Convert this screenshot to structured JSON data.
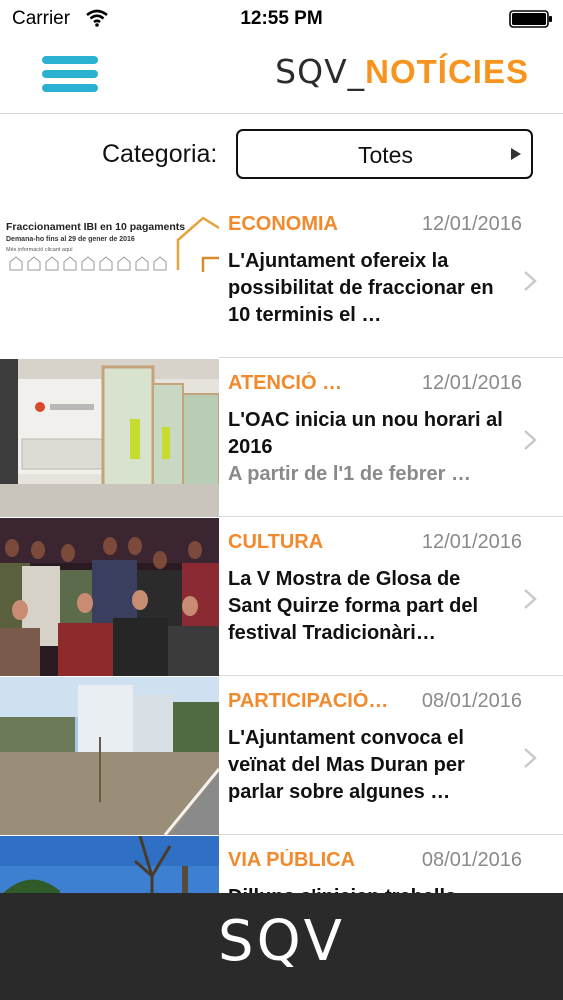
{
  "status_bar": {
    "carrier": "Carrier",
    "time": "12:55 PM"
  },
  "nav": {
    "brand_prefix": "SQV_",
    "brand_suffix": "NOTÍCIES"
  },
  "filter": {
    "label": "Categoria:",
    "value": "Totes"
  },
  "news": [
    {
      "category": "ECONOMIA",
      "date": "12/01/2016",
      "title": "L'Ajuntament ofereix la possibilitat de fraccionar en 10 terminis el …",
      "subtitle": "",
      "thumb": {
        "line1": "Fraccionament IBI en 10 pagaments",
        "line2": "Demana-ho fins al 29 de gener de 2016",
        "line3": "Més informació clicant aquí"
      }
    },
    {
      "category": "ATENCIÓ …",
      "date": "12/01/2016",
      "title": "L'OAC inicia un nou horari al 2016",
      "subtitle": "A partir de l'1 de febrer …",
      "thumb": {}
    },
    {
      "category": "CULTURA",
      "date": "12/01/2016",
      "title": "La V Mostra de Glosa de Sant Quirze forma part del festival Tradicionàri…",
      "subtitle": "",
      "thumb": {}
    },
    {
      "category": "PARTICIPACIÓ…",
      "date": "08/01/2016",
      "title": "L'Ajuntament convoca el veïnat del Mas Duran per parlar sobre algunes …",
      "subtitle": "",
      "thumb": {}
    },
    {
      "category": "VIA PÚBLICA",
      "date": "08/01/2016",
      "title": "Dilluns s'inicien treballs",
      "subtitle": "",
      "thumb": {}
    }
  ],
  "footer": {
    "logo": "SQV"
  },
  "colors": {
    "accent_orange": "#f08a2c",
    "menu_blue": "#2ab1d1",
    "footer_dark": "#2a2a2a"
  }
}
